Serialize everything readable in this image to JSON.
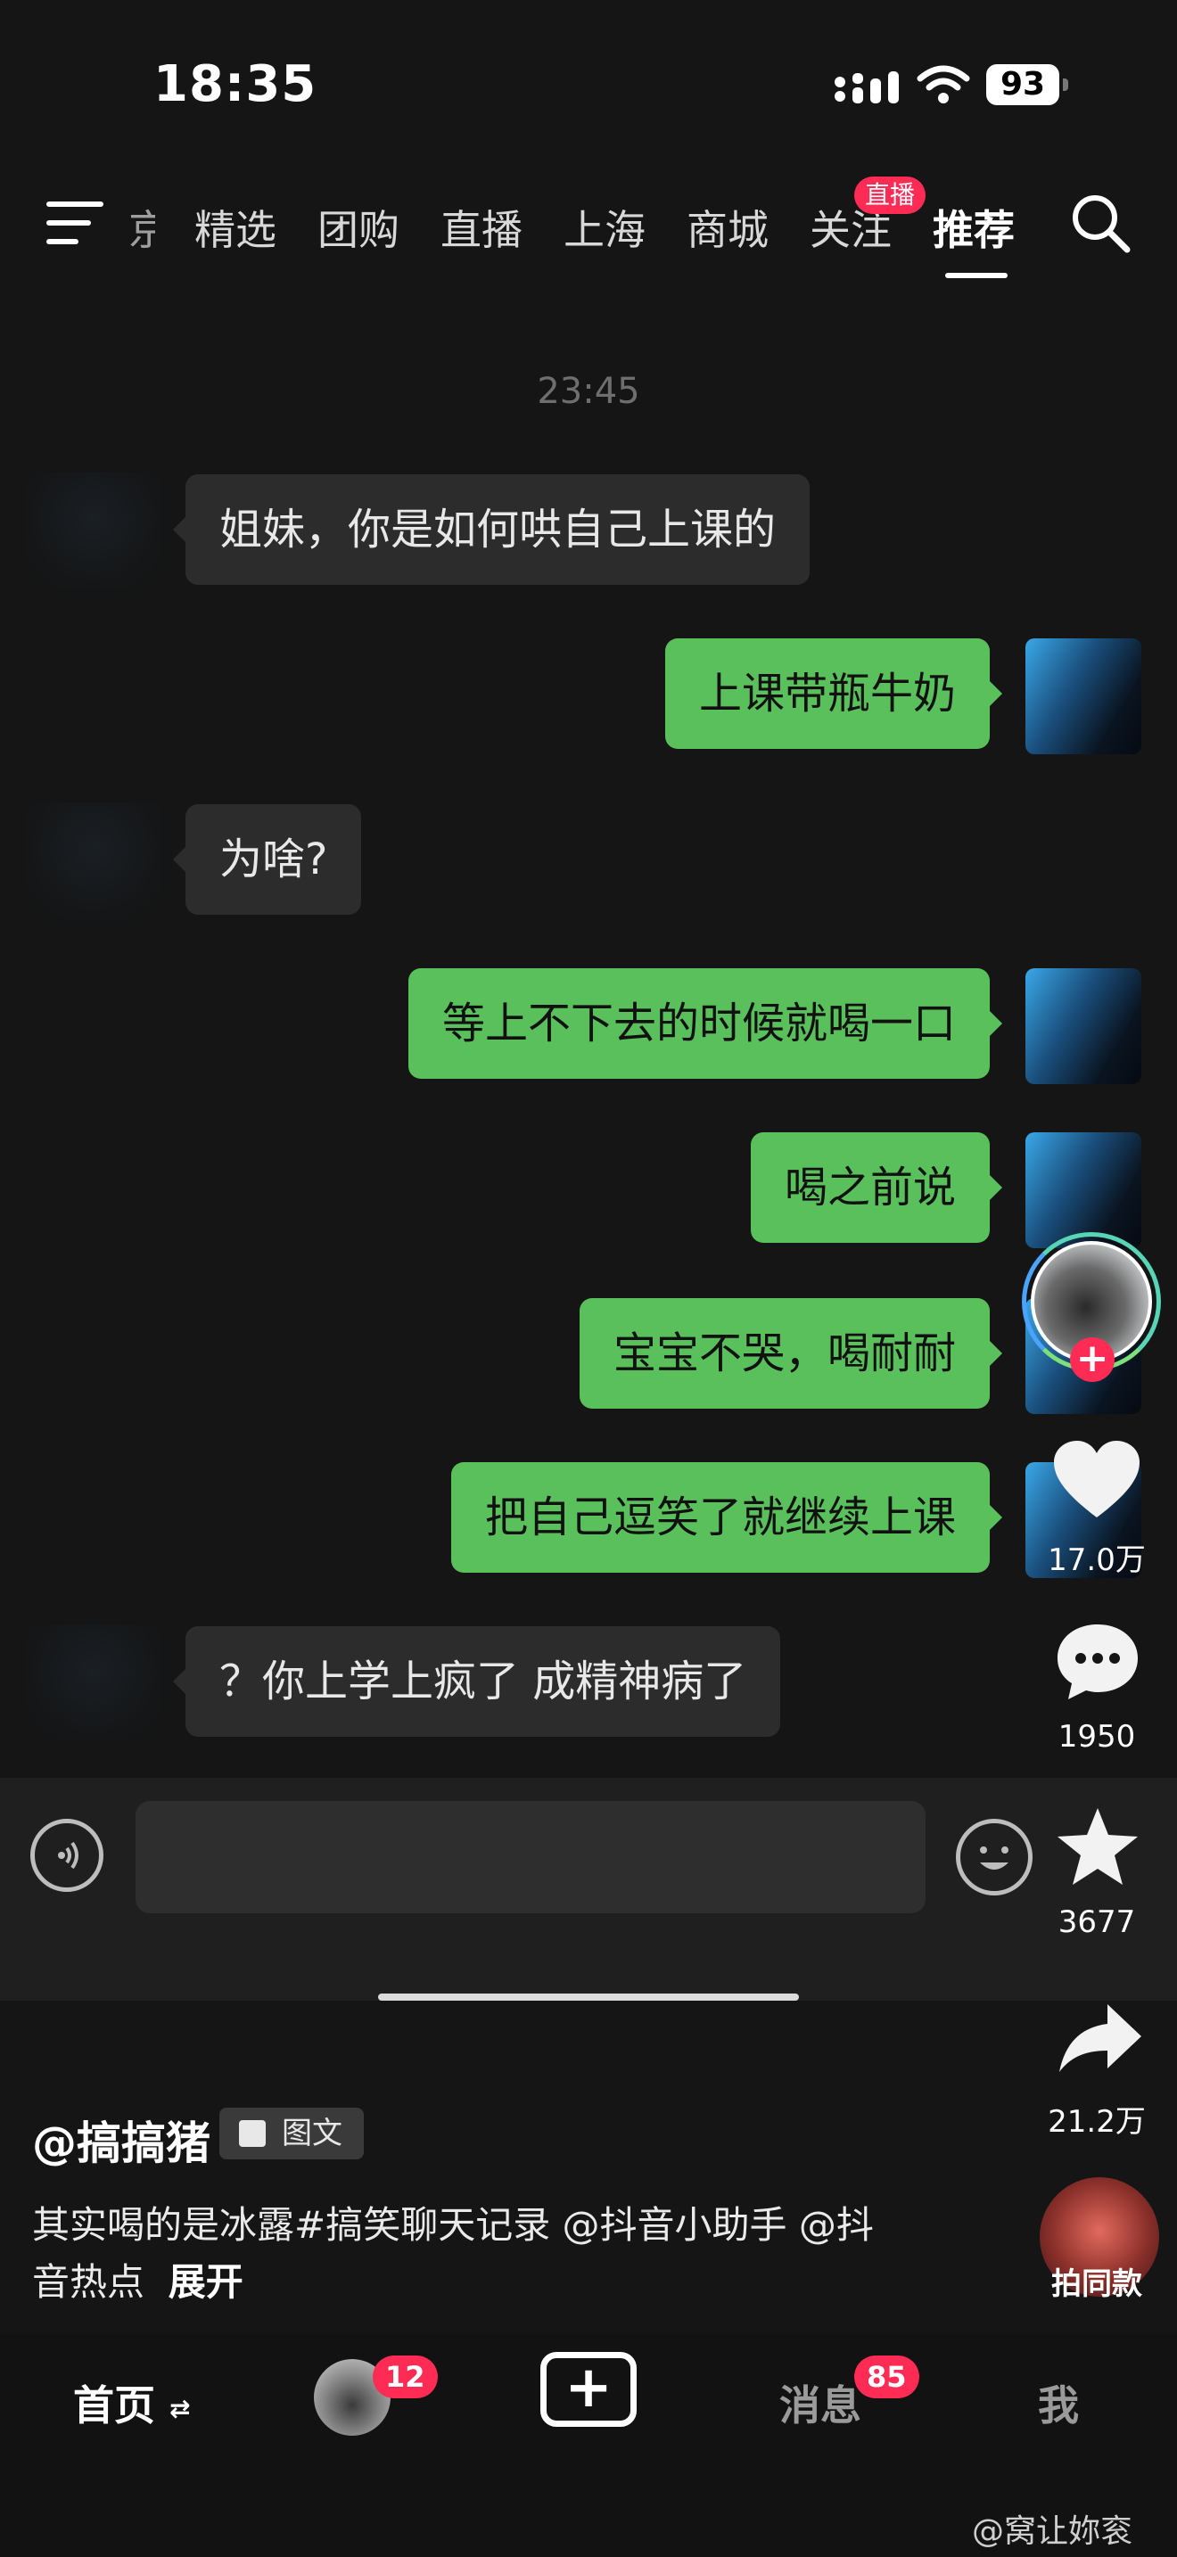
{
  "status_bar": {
    "time": "18:35",
    "battery": "93"
  },
  "top_nav": {
    "items": [
      "京",
      "精选",
      "团购",
      "直播",
      "上海",
      "商城",
      "关注",
      "推荐"
    ],
    "active_index": 7,
    "live_badge": "直播"
  },
  "chat": {
    "timestamp": "23:45",
    "messages": [
      {
        "side": "left",
        "text": "姐妹，你是如何哄自己上课的"
      },
      {
        "side": "right",
        "text": "上课带瓶牛奶"
      },
      {
        "side": "left",
        "text": "为啥?"
      },
      {
        "side": "right",
        "text": "等上不下去的时候就喝一口"
      },
      {
        "side": "right",
        "text": "喝之前说"
      },
      {
        "side": "right",
        "text": "宝宝不哭，喝耐耐"
      },
      {
        "side": "right",
        "text": "把自己逗笑了就继续上课"
      },
      {
        "side": "left",
        "text": "？你上学上疯了 成精神病了"
      }
    ]
  },
  "actions": {
    "likes": "17.0万",
    "comments": "1950",
    "favorites": "3677",
    "shares": "21.2万",
    "same_style": "拍同款"
  },
  "post": {
    "author": "@搞搞猪",
    "type_tag": "图文",
    "caption_line1": "其实喝的是冰露#搞笑聊天记录 @抖音小助手 @抖",
    "caption_line2": "音热点",
    "expand": "展开"
  },
  "tab_bar": {
    "home": "首页",
    "friends_badge": "12",
    "messages": "消息",
    "messages_badge": "85",
    "me": "我"
  },
  "watermark": "@窝让妳衮",
  "colors": {
    "accent": "#fe2c55",
    "bubble_self": "#5ac05c",
    "bubble_other": "#2c2c2c"
  }
}
